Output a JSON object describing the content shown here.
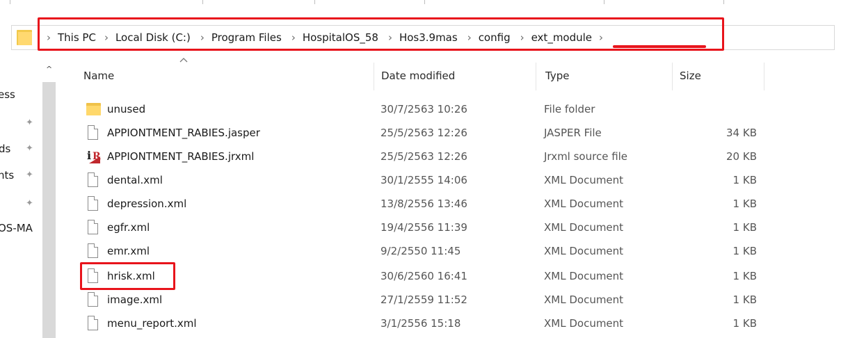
{
  "address_bar": {
    "breadcrumbs": [
      "This PC",
      "Local Disk (C:)",
      "Program Files",
      "HospitalOS_58",
      "Hos3.9mas",
      "config",
      "ext_module"
    ],
    "separator": "›"
  },
  "nav_pane": {
    "items": [
      {
        "label": "ess",
        "pinned": false
      },
      {
        "label": "",
        "pinned": true
      },
      {
        "label": "ds",
        "pinned": true
      },
      {
        "label": "nts",
        "pinned": true
      },
      {
        "label": "",
        "pinned": true
      },
      {
        "label": "OS-MA",
        "pinned": false
      }
    ],
    "scroll_up_glyph": "^"
  },
  "columns": {
    "name": "Name",
    "date": "Date modified",
    "type": "Type",
    "size": "Size"
  },
  "files": [
    {
      "name": "unused",
      "date": "30/7/2563 10:26",
      "type": "File folder",
      "size": "",
      "icon": "folder-icon"
    },
    {
      "name": "APPIONTMENT_RABIES.jasper",
      "date": "25/5/2563 12:26",
      "type": "JASPER File",
      "size": "34 KB",
      "icon": "file-icon"
    },
    {
      "name": "APPIONTMENT_RABIES.jrxml",
      "date": "25/5/2563 12:26",
      "type": "Jrxml source file",
      "size": "20 KB",
      "icon": "jrxml-icon"
    },
    {
      "name": "dental.xml",
      "date": "30/1/2555 14:06",
      "type": "XML Document",
      "size": "1 KB",
      "icon": "file-icon"
    },
    {
      "name": "depression.xml",
      "date": "13/8/2556 13:46",
      "type": "XML Document",
      "size": "1 KB",
      "icon": "file-icon"
    },
    {
      "name": "egfr.xml",
      "date": "19/4/2556 11:39",
      "type": "XML Document",
      "size": "1 KB",
      "icon": "file-icon"
    },
    {
      "name": "emr.xml",
      "date": "9/2/2550 11:45",
      "type": "XML Document",
      "size": "1 KB",
      "icon": "file-icon"
    },
    {
      "name": "hrisk.xml",
      "date": "30/6/2560 16:41",
      "type": "XML Document",
      "size": "1 KB",
      "icon": "file-icon"
    },
    {
      "name": "image.xml",
      "date": "27/1/2559 11:52",
      "type": "XML Document",
      "size": "1 KB",
      "icon": "file-icon"
    },
    {
      "name": "menu_report.xml",
      "date": "3/1/2556 15:18",
      "type": "XML Document",
      "size": "1 KB",
      "icon": "file-icon"
    }
  ],
  "colors": {
    "highlight_red": "#e8141b",
    "folder_yellow": "#ffd86b"
  }
}
